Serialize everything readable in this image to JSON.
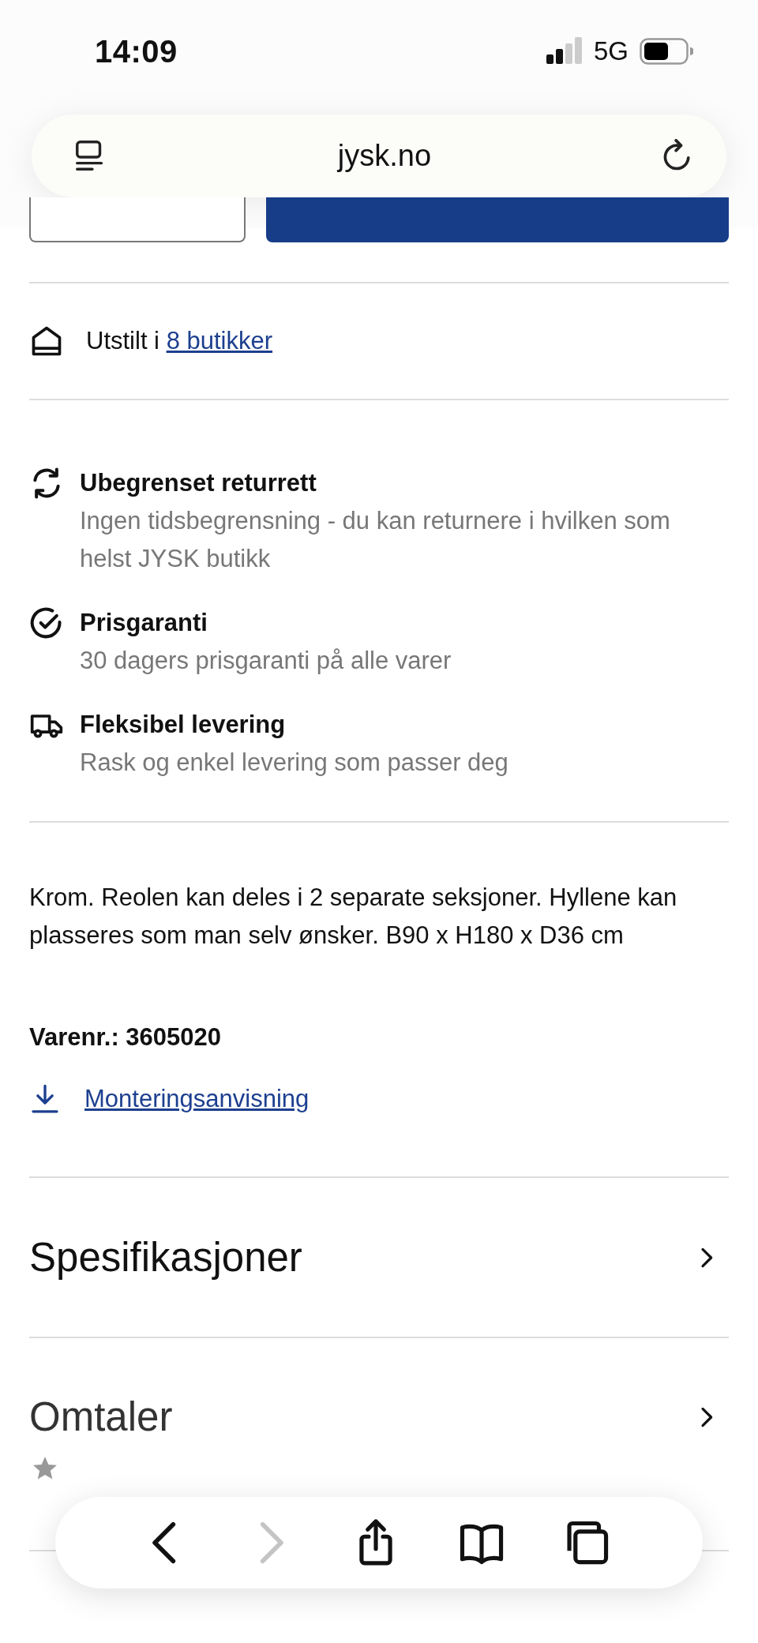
{
  "status_bar": {
    "time": "14:09",
    "network": "5G"
  },
  "address_bar": {
    "url": "jysk.no"
  },
  "display": {
    "prefix": "Utstilt i ",
    "link": "8 butikker"
  },
  "features": [
    {
      "kind": "returns",
      "title": "Ubegrenset returrett",
      "text": "Ingen tidsbegrensning - du kan returnere i hvilken som helst JYSK butikk"
    },
    {
      "kind": "guarantee",
      "title": "Prisgaranti",
      "text": "30 dagers prisgaranti på alle varer"
    },
    {
      "kind": "delivery",
      "title": "Fleksibel levering",
      "text": "Rask og enkel levering som passer deg"
    }
  ],
  "description": "Krom. Reolen kan deles i 2 separate seksjoner. Hyllene kan plasseres som man selv ønsker. B90 x H180 x D36 cm",
  "item_number": "Varenr.: 3605020",
  "download_link": "Monteringsanvisning",
  "sections": [
    {
      "title": "Spesifikasjoner"
    },
    {
      "title": "Omtaler"
    }
  ],
  "toolbar": [
    {
      "kind": "back",
      "disabled": false
    },
    {
      "kind": "forward",
      "disabled": true
    },
    {
      "kind": "share",
      "disabled": false
    },
    {
      "kind": "bookmarks",
      "disabled": false
    },
    {
      "kind": "tabs",
      "disabled": false
    }
  ]
}
